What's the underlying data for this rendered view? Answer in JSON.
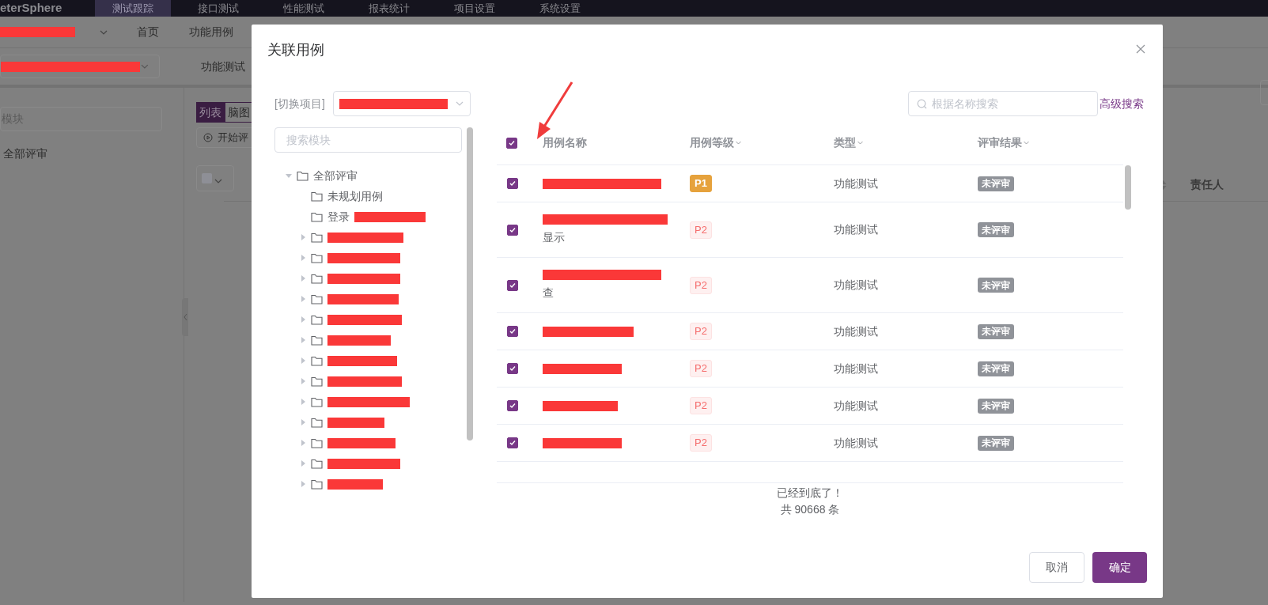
{
  "nav": {
    "logo": "eterSphere",
    "tabs": [
      {
        "label": "测试跟踪",
        "selected": true
      },
      {
        "label": "接口测试",
        "selected": false
      },
      {
        "label": "性能测试",
        "selected": false
      },
      {
        "label": "报表统计",
        "selected": false
      },
      {
        "label": "项目设置",
        "selected": false
      },
      {
        "label": "系统设置",
        "selected": false
      }
    ]
  },
  "subnav": {
    "items": [
      "首页",
      "功能用例"
    ]
  },
  "background": {
    "tab": "功能测试",
    "module_search_placeholder": "模块",
    "tree_root": "全部评审",
    "view_tabs": [
      {
        "label": "列表",
        "selected": true
      },
      {
        "label": "脑图",
        "selected": false
      }
    ],
    "start_button": "开始评",
    "column_header": "责任人"
  },
  "dialog": {
    "title": "关联用例",
    "project_label": "[切换项目]",
    "module_search_placeholder": "搜索模块",
    "tree": [
      {
        "label": "全部评审",
        "kind": "branch",
        "expanded": true,
        "redacted": false,
        "children": [
          {
            "label": "未规划用例",
            "kind": "leaf",
            "redacted": false
          },
          {
            "label": "登录",
            "kind": "leaf",
            "redacted": true
          },
          {
            "kind": "branch",
            "expanded": false,
            "redacted": true
          },
          {
            "kind": "branch",
            "expanded": false,
            "redacted": true
          },
          {
            "kind": "branch",
            "expanded": false,
            "redacted": true
          },
          {
            "kind": "branch",
            "expanded": false,
            "redacted": true
          },
          {
            "kind": "branch",
            "expanded": false,
            "redacted": true
          },
          {
            "kind": "branch",
            "expanded": false,
            "redacted": true
          },
          {
            "kind": "branch",
            "expanded": false,
            "redacted": true
          },
          {
            "kind": "branch",
            "expanded": false,
            "redacted": true
          },
          {
            "kind": "branch",
            "expanded": false,
            "redacted": true
          },
          {
            "kind": "branch",
            "expanded": false,
            "redacted": true
          },
          {
            "kind": "branch",
            "expanded": false,
            "redacted": true
          },
          {
            "kind": "branch",
            "expanded": false,
            "redacted": true
          },
          {
            "kind": "branch",
            "expanded": false,
            "redacted": true
          }
        ]
      }
    ],
    "search_placeholder": "根据名称搜索",
    "advanced_search": "高级搜索",
    "table": {
      "select_all_checked": true,
      "columns": [
        {
          "label": "用例名称",
          "filter": false
        },
        {
          "label": "用例等级",
          "filter": true
        },
        {
          "label": "类型",
          "filter": true
        },
        {
          "label": "评审结果",
          "filter": true
        }
      ],
      "rows": [
        {
          "checked": true,
          "name_redacted": true,
          "priority": "P1",
          "color": "#e6a23c",
          "type": "功能测试",
          "result": "未评审"
        },
        {
          "checked": true,
          "name_redacted": true,
          "name_rest": "显示",
          "priority": "P2",
          "color": "#f56c6c",
          "type": "功能测试",
          "result": "未评审"
        },
        {
          "checked": true,
          "name_redacted": true,
          "name_rest": "查",
          "priority": "P2",
          "color": "#f56c6c",
          "type": "功能测试",
          "result": "未评审"
        },
        {
          "checked": true,
          "name_redacted": true,
          "priority": "P2",
          "color": "#f56c6c",
          "type": "功能测试",
          "result": "未评审"
        },
        {
          "checked": true,
          "name_redacted": true,
          "priority": "P2",
          "color": "#f56c6c",
          "type": "功能测试",
          "result": "未评审"
        },
        {
          "checked": true,
          "name_redacted": true,
          "priority": "P2",
          "color": "#f56c6c",
          "type": "功能测试",
          "result": "未评审"
        },
        {
          "checked": true,
          "name_redacted": true,
          "priority": "P2",
          "color": "#f56c6c",
          "type": "功能测试",
          "result": "未评审"
        }
      ]
    },
    "end_note": "已经到底了！",
    "total": "共 90668 条",
    "cancel_button": "取消",
    "confirm_button": "确定"
  }
}
